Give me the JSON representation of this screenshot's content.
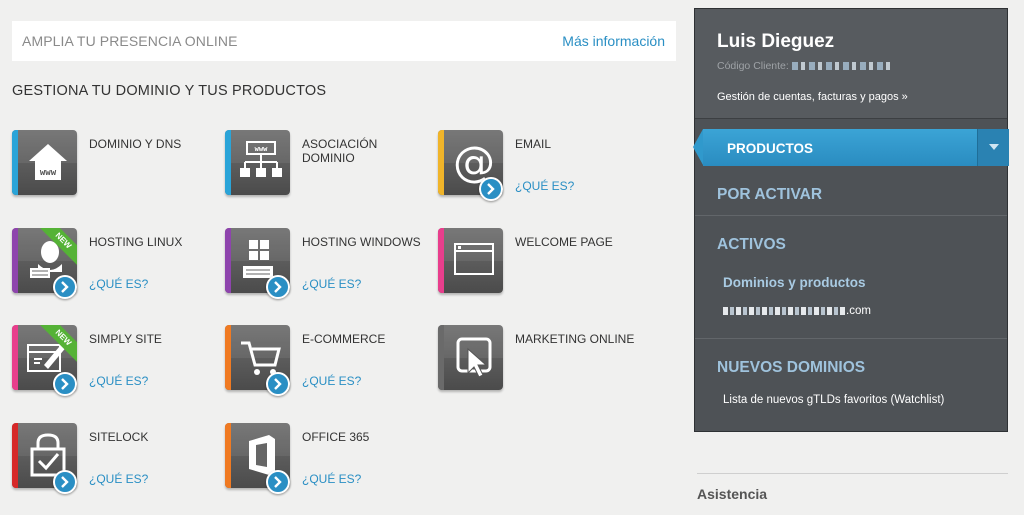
{
  "banner": {
    "text": "AMPLIA TU PRESENCIA ONLINE",
    "link": "Más información"
  },
  "section_title": "GESTIONA TU DOMINIO Y TUS PRODUCTOS",
  "colors": {
    "accent": "#2a8fc4",
    "new_badge": "#55b236"
  },
  "products": [
    {
      "name": "DOMINIO Y DNS",
      "link": "",
      "stripe": "#2aa4d8",
      "icon": "house-www-icon"
    },
    {
      "name": "ASOCIACIÓN DOMINIO",
      "link": "",
      "stripe": "#2aa4d8",
      "icon": "network-www-icon"
    },
    {
      "name": "EMAIL",
      "link": "¿QUÉ ES?",
      "stripe": "#f0b429",
      "icon": "at-sign-icon"
    },
    {
      "name": "HOSTING LINUX",
      "link": "¿QUÉ ES?",
      "stripe": "#8e44ad",
      "icon": "linux-server-icon",
      "badge": "NEW"
    },
    {
      "name": "HOSTING WINDOWS",
      "link": "¿QUÉ ES?",
      "stripe": "#8e44ad",
      "icon": "windows-server-icon"
    },
    {
      "name": "WELCOME PAGE",
      "link": "",
      "stripe": "#e83e8c",
      "icon": "browser-window-icon"
    },
    {
      "name": "SIMPLY SITE",
      "link": "¿QUÉ ES?",
      "stripe": "#e83e8c",
      "icon": "site-builder-icon",
      "badge": "NEW"
    },
    {
      "name": "E-COMMERCE",
      "link": "¿QUÉ ES?",
      "stripe": "#f07a22",
      "icon": "shopping-cart-icon"
    },
    {
      "name": "MARKETING ONLINE",
      "link": "",
      "stripe": "#6a6a6a",
      "icon": "cursor-click-icon"
    },
    {
      "name": "SITELOCK",
      "link": "¿QUÉ ES?",
      "stripe": "#d62828",
      "icon": "lock-check-icon"
    },
    {
      "name": "OFFICE 365",
      "link": "¿QUÉ ES?",
      "stripe": "#f07a22",
      "icon": "office-logo-icon"
    }
  ],
  "user": {
    "name": "Luis Dieguez",
    "client_code_label": "Código Cliente:",
    "account_link": "Gestión de cuentas, facturas y pagos »"
  },
  "nav": {
    "products_tab": "PRODUCTOS",
    "pending": "POR ACTIVAR",
    "active": "ACTIVOS",
    "domains_products": "Dominios y productos",
    "domain_suffix": ".com",
    "new_domains": "NUEVOS DOMINIOS",
    "watchlist": "Lista de nuevos gTLDs favoritos (Watchlist)"
  },
  "assist": "Asistencia"
}
